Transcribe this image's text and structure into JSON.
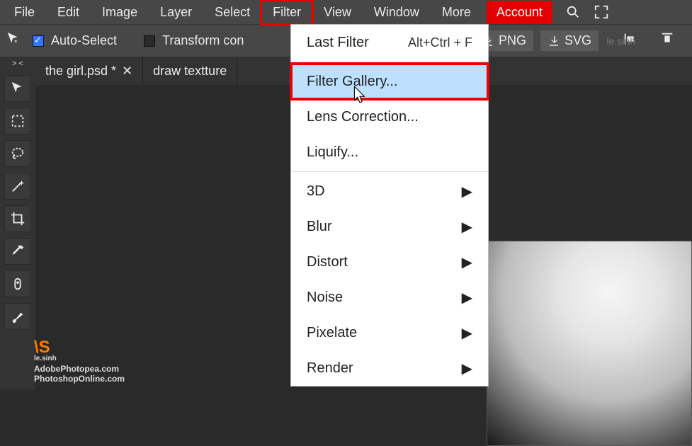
{
  "menubar": {
    "items": [
      "File",
      "Edit",
      "Image",
      "Layer",
      "Select",
      "Filter",
      "View",
      "Window",
      "More"
    ],
    "account": "Account",
    "active_index": 5
  },
  "optionsbar": {
    "auto_select": "Auto-Select",
    "transform": "Transform con",
    "export_png": "PNG",
    "export_svg": "SVG"
  },
  "tabs": [
    {
      "title": "the girl.psd *",
      "closeable": true
    },
    {
      "title": "draw textture",
      "closeable": false
    }
  ],
  "toolbox_header": "> <",
  "dropdown": {
    "items": [
      {
        "label": "Last Filter",
        "shortcut": "Alt+Ctrl + F",
        "submenu": false,
        "highlight": false
      },
      {
        "sep": true
      },
      {
        "label": "Filter Gallery...",
        "submenu": false,
        "highlight": true
      },
      {
        "label": "Lens Correction...",
        "submenu": false,
        "highlight": false
      },
      {
        "label": "Liquify...",
        "submenu": false,
        "highlight": false
      },
      {
        "sep": true
      },
      {
        "label": "3D",
        "submenu": true,
        "highlight": false
      },
      {
        "label": "Blur",
        "submenu": true,
        "highlight": false
      },
      {
        "label": "Distort",
        "submenu": true,
        "highlight": false
      },
      {
        "label": "Noise",
        "submenu": true,
        "highlight": false
      },
      {
        "label": "Pixelate",
        "submenu": true,
        "highlight": false
      },
      {
        "label": "Render",
        "submenu": true,
        "highlight": false
      }
    ]
  },
  "watermark": {
    "logo": "\\S",
    "logo_sub": "le.sinh",
    "line1": "AdobePhotopea.com",
    "line2": "PhotoshopOnline.com"
  }
}
